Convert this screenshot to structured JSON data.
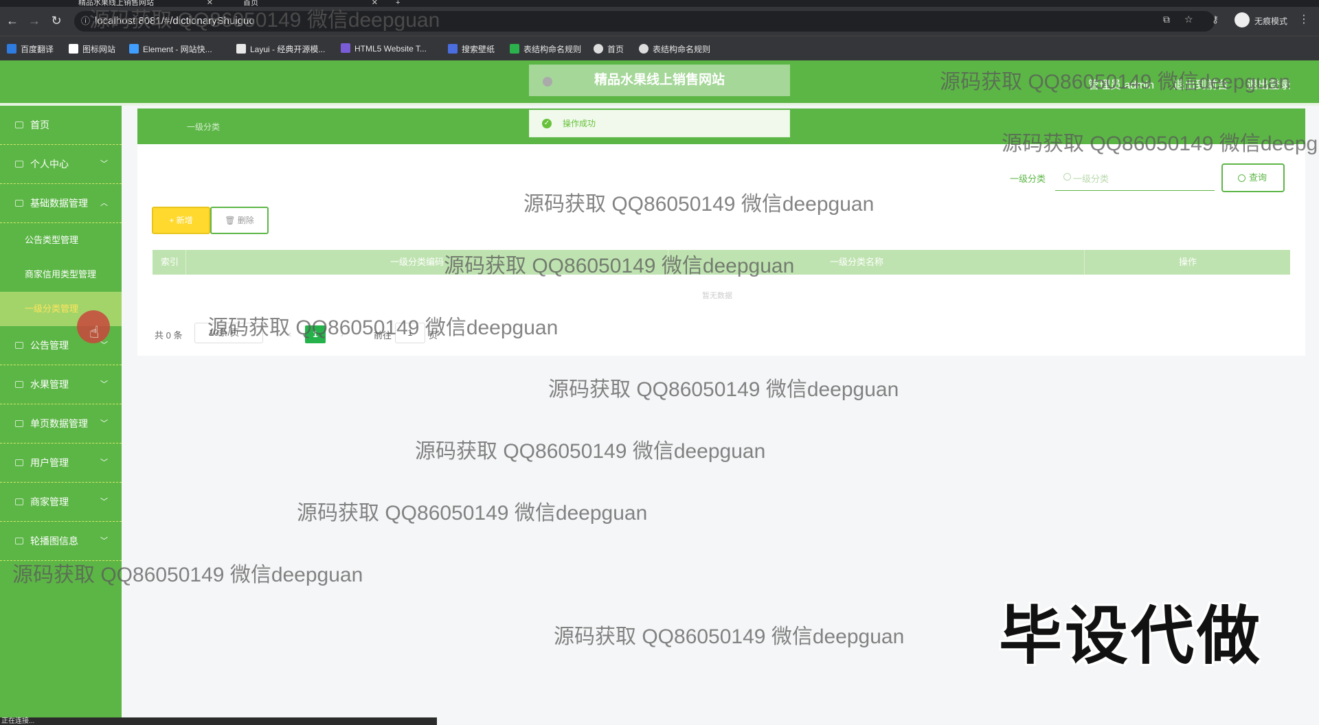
{
  "browser": {
    "tabs": [
      {
        "label": "精品水果线上销售网站"
      },
      {
        "label": "首页"
      }
    ],
    "new_tab": "+",
    "url": "localhost:8081/#/dictionaryShuiguo",
    "incognito_label": "无痕模式",
    "bookmarks": [
      {
        "label": "百度翻译",
        "color": "#2f7ce0"
      },
      {
        "label": "图标网站",
        "color": "#ffffff"
      },
      {
        "label": "Element - 网站快...",
        "color": "#409eff"
      },
      {
        "label": "Layui - 经典开源模...",
        "color": "#e8e8e8"
      },
      {
        "label": "HTML5 Website T...",
        "color": "#7a5cd6"
      },
      {
        "label": "搜索壁纸",
        "color": "#4a6ee0"
      },
      {
        "label": "表结构命名规则",
        "color": "#2bb24c"
      },
      {
        "label": "首页",
        "color": "#dddddd"
      },
      {
        "label": "表结构命名规则",
        "color": "#dddddd"
      }
    ]
  },
  "header": {
    "title": "精品水果线上销售网站",
    "user": "管理员 admin",
    "back_front": "退出到前台",
    "logout": "退出登录"
  },
  "sidebar": {
    "items": [
      {
        "label": "首页",
        "arrow": ""
      },
      {
        "label": "个人中心",
        "arrow": "﹀"
      },
      {
        "label": "基础数据管理",
        "arrow": "︿"
      },
      {
        "label": "公告类型管理",
        "arrow": ""
      },
      {
        "label": "商家信用类型管理",
        "arrow": ""
      },
      {
        "label": "一级分类管理",
        "arrow": ""
      },
      {
        "label": "公告管理",
        "arrow": "﹀"
      },
      {
        "label": "水果管理",
        "arrow": "﹀"
      },
      {
        "label": "单页数据管理",
        "arrow": "﹀"
      },
      {
        "label": "用户管理",
        "arrow": "﹀"
      },
      {
        "label": "商家管理",
        "arrow": "﹀"
      },
      {
        "label": "轮播图信息",
        "arrow": "﹀"
      }
    ]
  },
  "breadcrumb": "一级分类",
  "toast": {
    "message": "操作成功"
  },
  "search": {
    "label": "一级分类",
    "placeholder": "一级分类",
    "button": "查询"
  },
  "actions": {
    "add": "+ 新增",
    "delete": "删除"
  },
  "table": {
    "columns": [
      "索引",
      "一级分类编码",
      "一级分类名称",
      "操作"
    ],
    "empty_text": "暂无数据"
  },
  "pagination": {
    "total": "共 0 条",
    "page_size": "10条/页",
    "prev": "‹",
    "current_page": "1",
    "next": "›",
    "goto": "前往",
    "goto_value": "1",
    "unit": "页"
  },
  "watermarks": {
    "text": "源码获取 QQ86050149 微信deepguan",
    "big": "毕设代做"
  },
  "status_text": "正在连接..."
}
